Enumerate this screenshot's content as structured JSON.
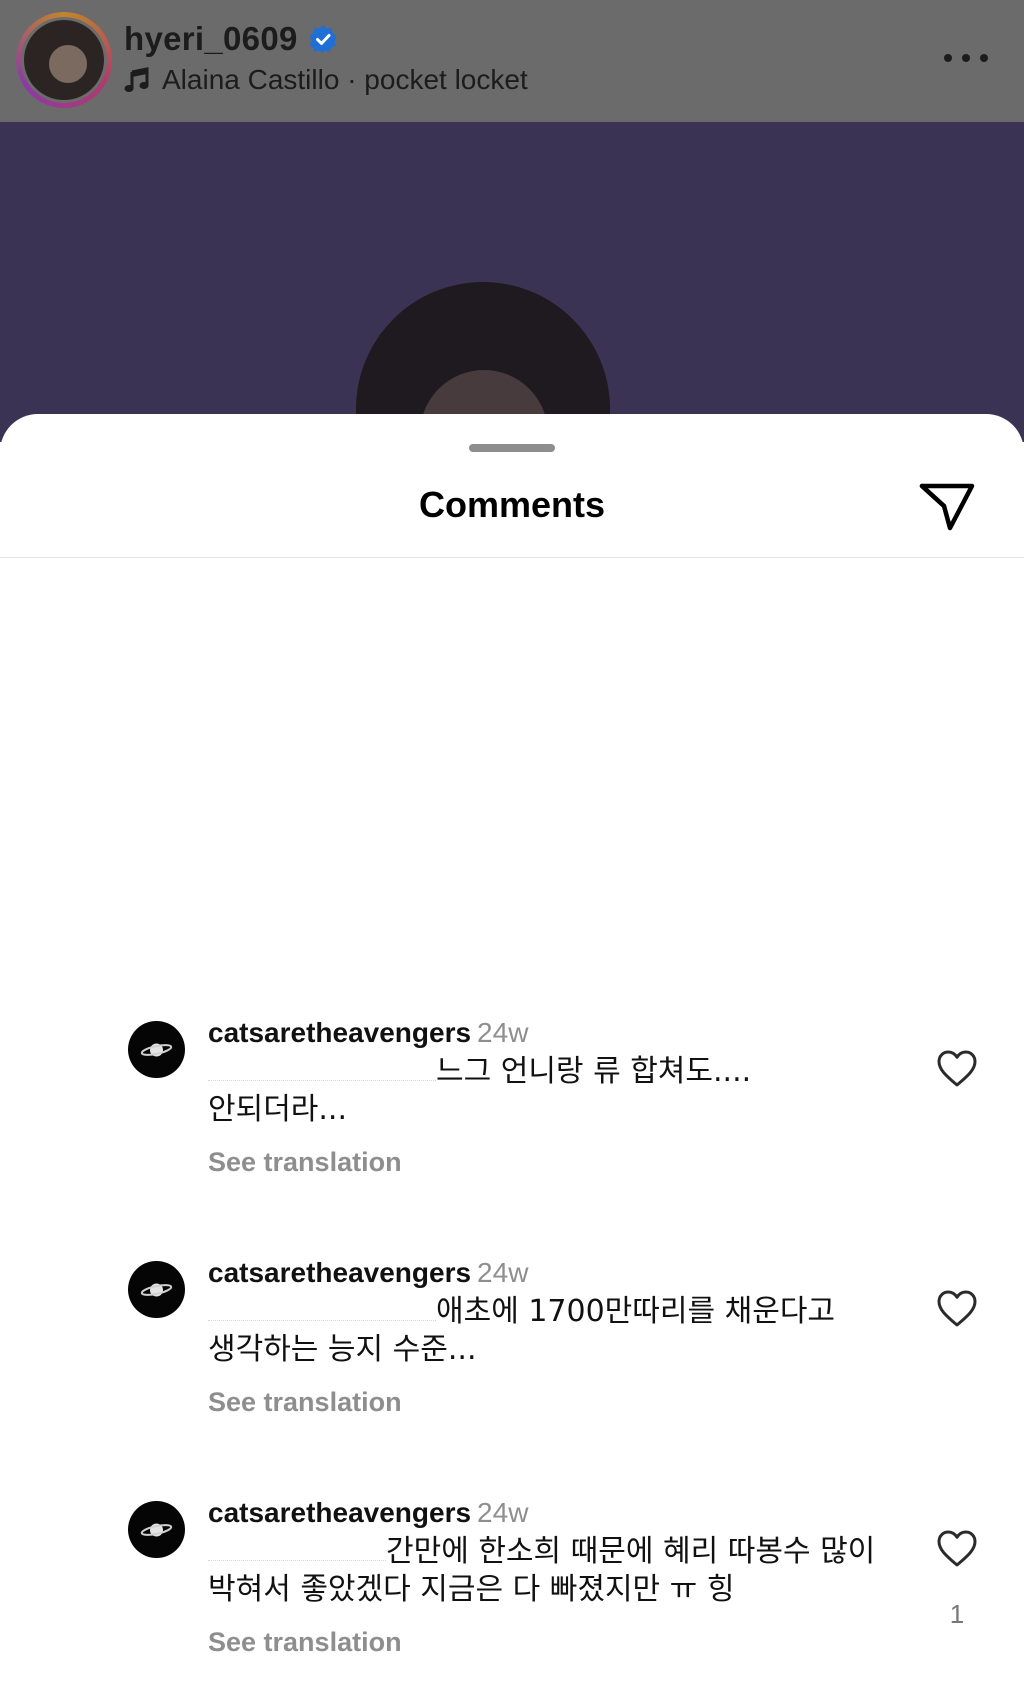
{
  "header": {
    "username": "hyeri_0609",
    "verified_icon": "verified-badge-icon",
    "music_icon": "music-note-icon",
    "music_text": "Alaina Castillo · pocket locket",
    "more_icon": "more-horizontal-icon",
    "accent_color": "#1877f2"
  },
  "sheet": {
    "title": "Comments",
    "share_icon": "paper-plane-icon"
  },
  "comments": [
    {
      "user": "catsaretheavengers",
      "time": "24w",
      "text": "느그 언니랑 류 합쳐도.... 안되더라...",
      "translate_label": "See translation",
      "like_icon": "heart-outline-icon",
      "likes": ""
    },
    {
      "user": "catsaretheavengers",
      "time": "24w",
      "text": "애초에 1700만따리를 채운다고 생각하는 능지 수준...",
      "translate_label": "See translation",
      "like_icon": "heart-outline-icon",
      "likes": ""
    },
    {
      "user": "catsaretheavengers",
      "time": "24w",
      "text": "간만에 한소희 때문에 혜리 따봉수 많이 박혀서 좋았겠다 지금은 다 빠졌지만 ㅠ 힝",
      "translate_label": "See translation",
      "like_icon": "heart-outline-icon",
      "likes": "1"
    }
  ]
}
